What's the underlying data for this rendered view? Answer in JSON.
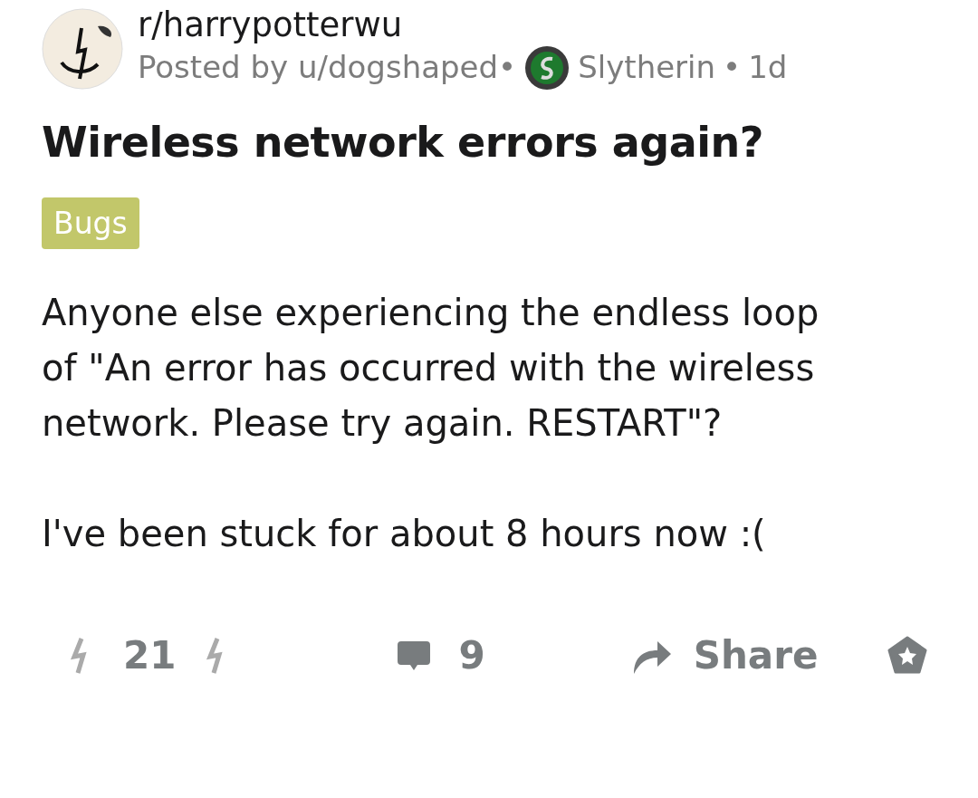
{
  "post": {
    "community": "r/harrypotterwu",
    "posted_by": "Posted by u/dogshaped•",
    "flair": "Slytherin",
    "separator": "•",
    "age": "1d",
    "title": "Wireless network errors again?",
    "tag": {
      "label": "Bugs",
      "color": "#c2c76a"
    },
    "body": [
      "Anyone else experiencing the endless loop of \"An error has occurred with the wireless network. Please try again. RESTART\"?",
      "I've been stuck for about 8 hours now :("
    ]
  },
  "actions": {
    "votes": "21",
    "comments": "9",
    "share": "Share"
  }
}
